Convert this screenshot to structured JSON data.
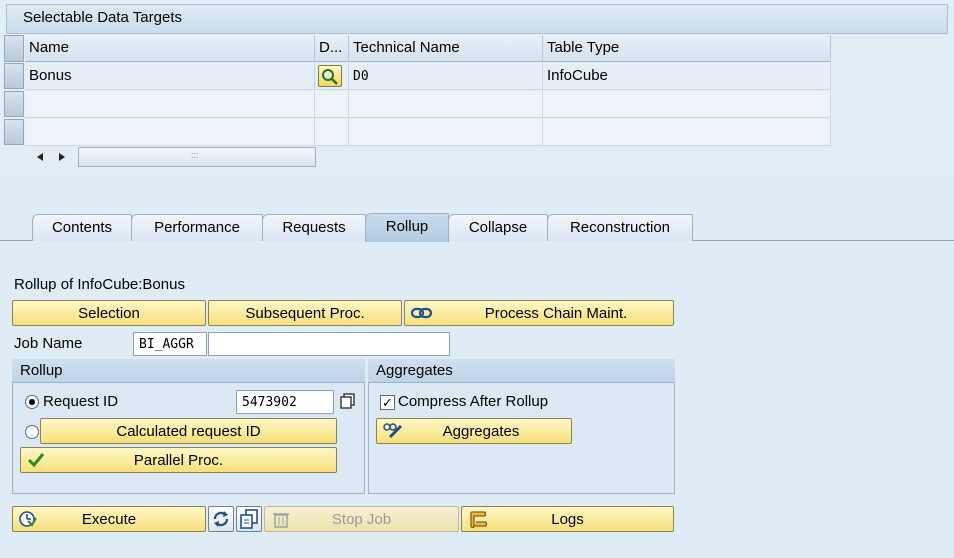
{
  "data_targets": {
    "title": "Selectable Data Targets",
    "columns": [
      "Name",
      "D...",
      "Technical Name",
      "Table Type"
    ],
    "rows": [
      {
        "name": "Bonus",
        "technical_name": "D0",
        "table_type": "InfoCube"
      }
    ],
    "scroll_grip": ":::"
  },
  "tabs": [
    "Contents",
    "Performance",
    "Requests",
    "Rollup",
    "Collapse",
    "Reconstruction"
  ],
  "active_tab": "Rollup",
  "rollup_panel": {
    "heading": "Rollup of InfoCube:Bonus",
    "buttons": {
      "selection": "Selection",
      "subsequent": "Subsequent Proc.",
      "process_chain": "Process Chain Maint."
    },
    "job_name_label": "Job Name",
    "job_name_value": "BI_AGGR",
    "job_name_extra": "",
    "rollup_group": {
      "title": "Rollup",
      "request_id_label": "Request ID",
      "request_id_value": "5473902",
      "calc_request_button": "Calculated request ID",
      "parallel_button": "Parallel Proc."
    },
    "aggregates_group": {
      "title": "Aggregates",
      "compress_label": "Compress After Rollup",
      "compress_checked": true,
      "aggregates_button": "Aggregates"
    },
    "bottom_buttons": {
      "execute": "Execute",
      "stop_job": "Stop Job",
      "logs": "Logs"
    }
  },
  "colors": {
    "background": "#dfebf5",
    "button": "#f7e07a",
    "accent_green": "#2e8b22"
  }
}
